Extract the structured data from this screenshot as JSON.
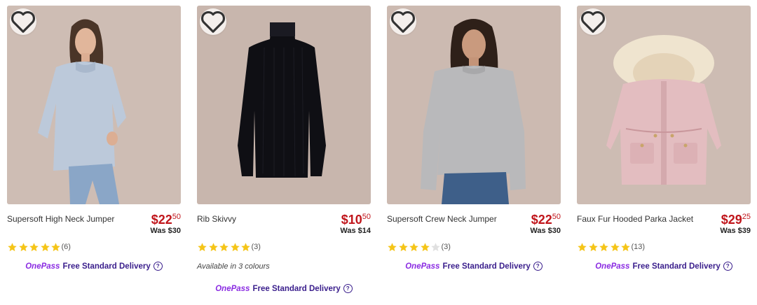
{
  "products": [
    {
      "title": "Supersoft High Neck Jumper",
      "price_dollars": "$22",
      "price_cents": "50",
      "was": "Was $30",
      "rating": 5,
      "review_count": "(6)",
      "delivery": {
        "brand": "OnePass",
        "text": "Free Standard Delivery"
      },
      "image": {
        "subject": "woman-in-light-blue-high-neck-jumper"
      }
    },
    {
      "title": "Rib Skivvy",
      "price_dollars": "$10",
      "price_cents": "50",
      "was": "Was $14",
      "rating": 5,
      "review_count": "(3)",
      "colours": "Available in 3 colours",
      "delivery": {
        "brand": "OnePass",
        "text": "Free Standard Delivery"
      },
      "image": {
        "subject": "black-rib-skivvy-flatlay"
      }
    },
    {
      "title": "Supersoft Crew Neck Jumper",
      "price_dollars": "$22",
      "price_cents": "50",
      "was": "Was $30",
      "rating": 4,
      "review_count": "(3)",
      "delivery": {
        "brand": "OnePass",
        "text": "Free Standard Delivery"
      },
      "image": {
        "subject": "woman-in-grey-crew-neck-jumper"
      }
    },
    {
      "title": "Faux Fur Hooded Parka Jacket",
      "price_dollars": "$29",
      "price_cents": "25",
      "was": "Was $39",
      "rating": 5,
      "review_count": "(13)",
      "delivery": {
        "brand": "OnePass",
        "text": "Free Standard Delivery"
      },
      "image": {
        "subject": "pink-faux-fur-parka-jacket"
      }
    }
  ],
  "colors": {
    "price_red": "#c0151b",
    "star_gold": "#f5c518",
    "star_empty": "#e0e0e0",
    "onepass_purple": "#8a2be2",
    "delivery_navy": "#3a1e8c",
    "image_bg": "#c7b6ad"
  }
}
